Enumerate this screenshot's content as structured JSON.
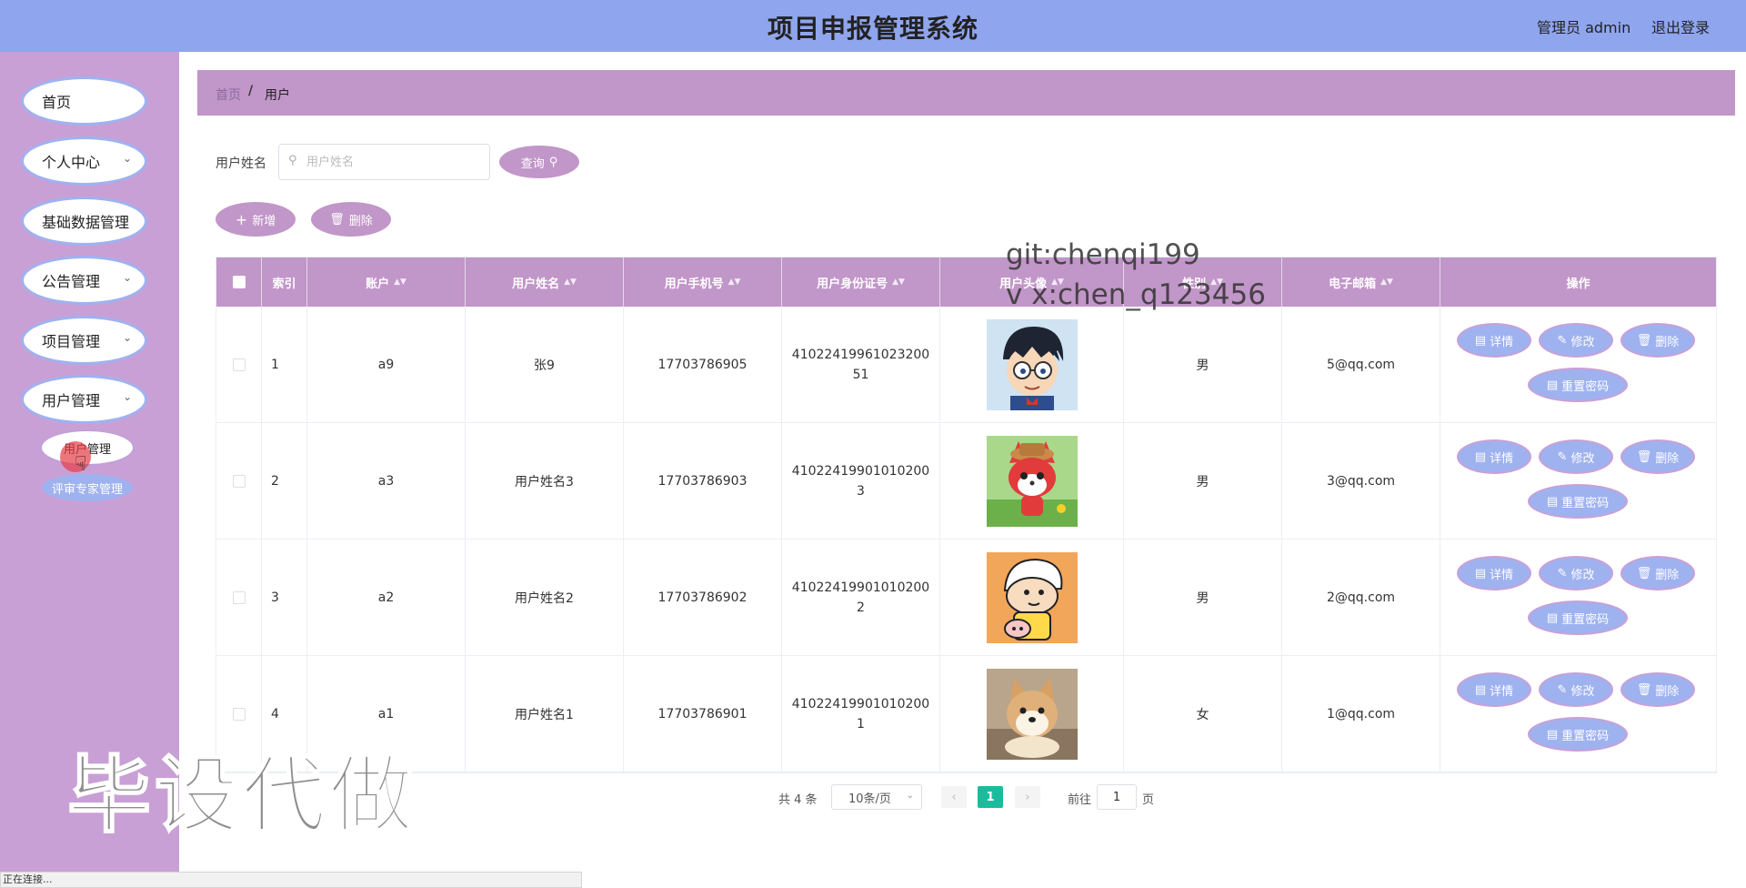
{
  "header": {
    "title": "项目申报管理系统",
    "admin_label": "管理员 admin",
    "logout": "退出登录",
    "bg_color": "#8fa5ee"
  },
  "sidebar": {
    "bg_color": "#c9a0d6",
    "items": [
      {
        "label": "首页",
        "has_chevron": false
      },
      {
        "label": "个人中心",
        "has_chevron": true
      },
      {
        "label": "基础数据管理",
        "has_chevron": false
      },
      {
        "label": "公告管理",
        "has_chevron": true
      },
      {
        "label": "项目管理",
        "has_chevron": true
      },
      {
        "label": "用户管理",
        "has_chevron": true
      }
    ],
    "subitems": [
      {
        "label": "用户管理",
        "active": true
      },
      {
        "label": "评审专家管理",
        "active": false
      }
    ]
  },
  "breadcrumb": {
    "home": "首页",
    "separator": "/",
    "current": "用户"
  },
  "search": {
    "label": "用户姓名",
    "placeholder": "用户姓名",
    "value": "",
    "button": "查询"
  },
  "actions": {
    "add": "新增",
    "delete": "删除"
  },
  "table": {
    "header_color": "#c196c8",
    "columns": [
      "索引",
      "账户",
      "用户姓名",
      "用户手机号",
      "用户身份证号",
      "用户头像",
      "性别",
      "电子邮箱",
      "操作"
    ],
    "rows": [
      {
        "index": "1",
        "account": "a9",
        "name": "张9",
        "phone": "17703786905",
        "id_card": "4102241996102320051",
        "avatar": "detective-boy-avatar",
        "gender": "男",
        "email": "5@qq.com"
      },
      {
        "index": "2",
        "account": "a3",
        "name": "用户姓名3",
        "phone": "17703786903",
        "id_card": "410224199010102003",
        "avatar": "red-fox-avatar",
        "gender": "男",
        "email": "3@qq.com"
      },
      {
        "index": "3",
        "account": "a2",
        "name": "用户姓名2",
        "phone": "17703786902",
        "id_card": "410224199010102002",
        "avatar": "cartoon-kid-avatar",
        "gender": "男",
        "email": "2@qq.com"
      },
      {
        "index": "4",
        "account": "a1",
        "name": "用户姓名1",
        "phone": "17703786901",
        "id_card": "410224199010102001",
        "avatar": "shiba-dog-avatar",
        "gender": "女",
        "email": "1@qq.com"
      }
    ],
    "row_actions": {
      "detail": "详情",
      "edit": "修改",
      "delete": "删除",
      "reset": "重置密码"
    }
  },
  "pagination": {
    "total": "共 4 条",
    "page_size": "10条/页",
    "prev": "‹",
    "current": "1",
    "next": "›",
    "goto": "前往",
    "goto_value": "1",
    "page_unit": "页",
    "accent": "#1abc9c"
  },
  "watermarks": {
    "line1": "git:chenqi199",
    "line2": "v x:chen_q123456",
    "big": "毕设代做"
  },
  "status_bar": "正在连接..."
}
